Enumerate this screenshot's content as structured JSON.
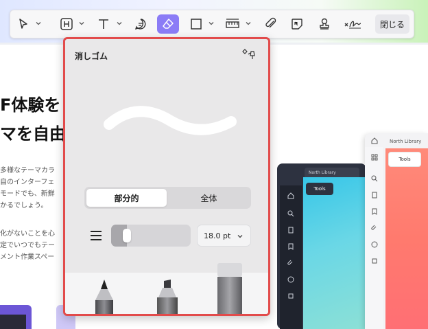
{
  "toolbar": {
    "items": [
      {
        "name": "select-tool",
        "icon": "cursor-icon"
      },
      {
        "name": "heading-tool",
        "icon": "heading-icon"
      },
      {
        "name": "text-tool",
        "icon": "text-icon"
      },
      {
        "name": "comment-tool",
        "icon": "comment-icon"
      },
      {
        "name": "eraser-tool",
        "icon": "eraser-icon",
        "active": true
      },
      {
        "name": "shape-tool",
        "icon": "rectangle-icon"
      },
      {
        "name": "measure-tool",
        "icon": "ruler-icon"
      },
      {
        "name": "attach-tool",
        "icon": "paperclip-icon"
      },
      {
        "name": "sticky-note-tool",
        "icon": "sticky-note-icon"
      },
      {
        "name": "stamp-tool",
        "icon": "stamp-icon"
      },
      {
        "name": "signature-tool",
        "icon": "signature-icon"
      }
    ],
    "close_label": "閉じる",
    "accent_color": "#8b7cf6"
  },
  "background": {
    "hero_line1": "F体験を",
    "hero_line2": "マを自由",
    "body_lines_a": [
      "多様なテーマカラ",
      "自のインターフェ",
      "モードでも、新鮮",
      "かるでしょう。"
    ],
    "body_lines_b": [
      "化がないことを心",
      "定でいつでもテー",
      "メント作業スペー"
    ],
    "mock_dark": {
      "tab_label": "North Library",
      "tools_label": "Tools"
    },
    "mock_light": {
      "tab_label": "North Library",
      "tools_label": "Tools"
    }
  },
  "eraser_panel": {
    "title": "消しゴム",
    "pin_icon": "pin-icon",
    "border_color": "#e24b4b",
    "modes": [
      {
        "label": "部分的",
        "active": true
      },
      {
        "label": "全体",
        "active": false
      }
    ],
    "size_fraction": 0.15,
    "size_value": "18.0 pt",
    "tools": [
      "pencil-eraser-icon",
      "marker-eraser-icon",
      "block-eraser-icon"
    ]
  }
}
